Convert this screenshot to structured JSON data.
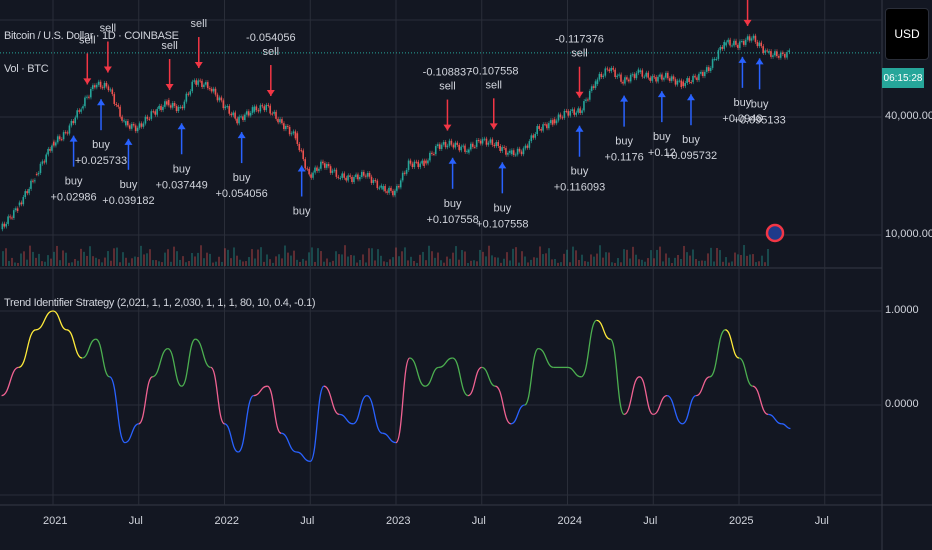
{
  "header": {
    "symbol_title": "Bitcoin / U.S. Dollar · 1D · COINBASE",
    "volume_label": "Vol · BTC"
  },
  "price_axis": {
    "currency_button": "USD",
    "countdown": "06:15:28",
    "ticks": [
      "40,000.00",
      "10,000.00"
    ]
  },
  "indicator": {
    "title": "Trend Identifier Strategy (2,021, 1, 1, 2,030, 1, 1, 1, 80, 10, 0.4, -0.1)",
    "ticks": [
      "1.0000",
      "0.0000"
    ]
  },
  "time_axis": {
    "ticks": [
      "2021",
      "Jul",
      "2022",
      "Jul",
      "2023",
      "Jul",
      "2024",
      "Jul",
      "2025",
      "Jul"
    ]
  },
  "colors": {
    "background": "#131722",
    "grid": "#2a2e39",
    "up": "#26a69a",
    "down": "#ef5350",
    "buy": "#2962ff",
    "sell": "#f23645",
    "last_price": "#26a69a"
  },
  "chart_data": [
    {
      "type": "line",
      "title": "Bitcoin / U.S. Dollar · 1D · COINBASE",
      "yscale": "log",
      "ylim": [
        7000,
        160000
      ],
      "x": [
        2020.7,
        2020.8,
        2020.9,
        2021.0,
        2021.08,
        2021.17,
        2021.25,
        2021.33,
        2021.42,
        2021.5,
        2021.58,
        2021.67,
        2021.75,
        2021.83,
        2021.92,
        2022.0,
        2022.08,
        2022.17,
        2022.25,
        2022.33,
        2022.42,
        2022.5,
        2022.58,
        2022.67,
        2022.75,
        2022.83,
        2022.92,
        2023.0,
        2023.08,
        2023.17,
        2023.25,
        2023.33,
        2023.42,
        2023.5,
        2023.58,
        2023.67,
        2023.75,
        2023.83,
        2023.92,
        2024.0,
        2024.08,
        2024.17,
        2024.25,
        2024.33,
        2024.42,
        2024.5,
        2024.58,
        2024.67,
        2024.75,
        2024.83,
        2024.92,
        2025.0,
        2025.08,
        2025.17,
        2025.25,
        2025.3
      ],
      "values": [
        10700,
        13800,
        19700,
        29000,
        33000,
        45000,
        58800,
        57000,
        37000,
        35000,
        41500,
        47000,
        43800,
        61300,
        57000,
        46200,
        38500,
        43200,
        45500,
        37700,
        31800,
        19900,
        23300,
        20000,
        19400,
        20500,
        17200,
        16500,
        23100,
        23100,
        28500,
        29200,
        27200,
        30500,
        29200,
        25900,
        27000,
        34600,
        37700,
        42300,
        42600,
        61100,
        71300,
        60600,
        67500,
        62700,
        64600,
        58900,
        63300,
        70200,
        96400,
        93400,
        102400,
        84300,
        82500,
        85000
      ],
      "signals": [
        {
          "date": 2021.12,
          "side": "buy",
          "label": "buy",
          "value": "+0.02986"
        },
        {
          "date": 2021.28,
          "side": "buy",
          "label": "buy",
          "value": "+0.025733"
        },
        {
          "date": 2021.2,
          "side": "sell",
          "label": "sell",
          "value": ""
        },
        {
          "date": 2021.32,
          "side": "sell",
          "label": "sell",
          "value": ""
        },
        {
          "date": 2021.44,
          "side": "buy",
          "label": "buy",
          "value": "+0.039182"
        },
        {
          "date": 2021.68,
          "side": "sell",
          "label": "sell",
          "value": ""
        },
        {
          "date": 2021.75,
          "side": "buy",
          "label": "buy",
          "value": "+0.037449"
        },
        {
          "date": 2021.85,
          "side": "sell",
          "label": "sell",
          "value": ""
        },
        {
          "date": 2022.1,
          "side": "buy",
          "label": "buy",
          "value": "+0.054056"
        },
        {
          "date": 2022.27,
          "side": "sell",
          "label": "sell",
          "value": "-0.054056"
        },
        {
          "date": 2022.45,
          "side": "buy",
          "label": "buy",
          "value": ""
        },
        {
          "date": 2023.3,
          "side": "sell",
          "label": "sell",
          "value": "-0.108837"
        },
        {
          "date": 2023.33,
          "side": "buy",
          "label": "buy",
          "value": "+0.107558"
        },
        {
          "date": 2023.57,
          "side": "sell",
          "label": "sell",
          "value": "-0.107558"
        },
        {
          "date": 2023.62,
          "side": "buy",
          "label": "buy",
          "value": "+0.107558"
        },
        {
          "date": 2024.07,
          "side": "sell",
          "label": "sell",
          "value": "-0.117376"
        },
        {
          "date": 2024.07,
          "side": "buy",
          "label": "buy",
          "value": "+0.116093"
        },
        {
          "date": 2024.33,
          "side": "buy",
          "label": "buy",
          "value": "+0.1176"
        },
        {
          "date": 2024.55,
          "side": "buy",
          "label": "buy",
          "value": "+0.12"
        },
        {
          "date": 2024.72,
          "side": "buy",
          "label": "buy",
          "value": "+0.095732"
        },
        {
          "date": 2025.05,
          "side": "sell",
          "label": "sell",
          "value": ""
        },
        {
          "date": 2025.02,
          "side": "buy",
          "label": "buy",
          "value": "+0.0948"
        },
        {
          "date": 2025.12,
          "side": "buy",
          "label": "buy",
          "value": "+0.095133"
        }
      ]
    },
    {
      "type": "line",
      "title": "Trend Identifier Strategy (2,021, 1, 1, 2,030, 1, 1, 1, 80, 10, 0.4, -0.1)",
      "ylim": [
        -1.0,
        1.25
      ],
      "x_same_as_price": true,
      "values": [
        0.1,
        0.4,
        0.8,
        1.0,
        0.8,
        0.5,
        0.7,
        0.3,
        -0.4,
        -0.2,
        0.3,
        0.6,
        0.2,
        0.7,
        0.4,
        -0.2,
        -0.5,
        0.1,
        0.2,
        -0.3,
        -0.5,
        -0.6,
        0.2,
        -0.1,
        -0.2,
        0.1,
        -0.3,
        -0.4,
        0.5,
        0.2,
        0.4,
        0.5,
        0.1,
        0.4,
        0.2,
        -0.2,
        0.0,
        0.6,
        0.4,
        0.4,
        0.3,
        0.9,
        0.7,
        -0.1,
        0.3,
        -0.1,
        0.1,
        -0.2,
        0.1,
        0.3,
        0.8,
        0.5,
        0.2,
        -0.1,
        -0.2,
        -0.25
      ]
    }
  ]
}
